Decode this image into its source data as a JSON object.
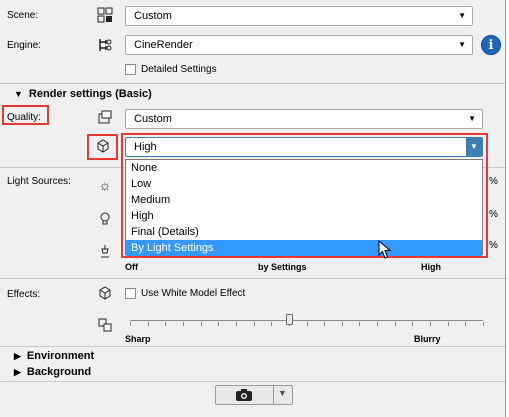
{
  "scene": {
    "label": "Scene:",
    "value": "Custom"
  },
  "engine": {
    "label": "Engine:",
    "value": "CineRender",
    "detailed_label": "Detailed Settings"
  },
  "render_settings": {
    "title": "Render settings (Basic)"
  },
  "quality": {
    "label": "Quality:",
    "preset": "Custom",
    "value": "High"
  },
  "dropdown": {
    "options": [
      "None",
      "Low",
      "Medium",
      "High",
      "Final (Details)",
      "By Light Settings"
    ],
    "highlighted": "By Light Settings"
  },
  "light_sources": {
    "label": "Light Sources:",
    "percent": "%",
    "scale": {
      "left": "Off",
      "mid": "by Settings",
      "right": "High"
    }
  },
  "effects": {
    "label": "Effects:",
    "white_model_label": "Use White Model Effect",
    "scale": {
      "left": "Sharp",
      "right": "Blurry"
    },
    "blur_level": 0.45
  },
  "sections": {
    "environment": "Environment",
    "background": "Background"
  },
  "icons": {
    "scene": "scene-grid-icon",
    "engine": "engine-tree-icon",
    "info": "info-icon",
    "quality": "quality-icon",
    "model": "model-cube-icon",
    "sun": "sun-icon",
    "bulb": "bulb-icon",
    "lamp": "lamp-icon",
    "effects": "effects-icon",
    "blur": "blur-icon",
    "camera": "camera-icon"
  },
  "colors": {
    "highlight": "#3399ff",
    "annotation": "#e53935",
    "info": "#1f66c4"
  }
}
